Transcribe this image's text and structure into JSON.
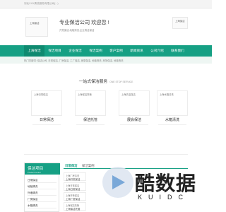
{
  "topbar": {
    "text": "河北XXX清洗服务有限公司(...)"
  },
  "header": {
    "logo": "上海保洁",
    "slogan": "专业保洁公司 欢迎您 !",
    "sub_slogan": "开荒保洁,地毯清洗,企业清洁保洁",
    "hotline": "上海保洁"
  },
  "nav": {
    "items": [
      "上海保洁",
      "保洁项目",
      "企业保洁",
      "保洁案例",
      "客户案例",
      "新闻资讯",
      "公司介绍",
      "联系我们"
    ],
    "active_index": 0
  },
  "keywords": "热门关键词: 保洁公司, 日常保洁, 厂房保洁, 工厂保洁, 家居保洁, 地毯清洗, 商场保洁, 地毯清洗",
  "services": {
    "title": "一站式保洁服务",
    "subtitle": "ONE STOP SERVICE",
    "items": [
      {
        "image_label": "上海日常保洁",
        "name": "日常保洁"
      },
      {
        "image_label": "上海保洁托管",
        "name": "保洁托管"
      },
      {
        "image_label": "上海清洁保洁",
        "name": "展会保洁"
      },
      {
        "image_label": "上海水箱清洗",
        "name": "水箱清洗"
      }
    ]
  },
  "product_center": {
    "title": "保洁项目",
    "subtitle": "Product Center",
    "items": [
      "日常保洁",
      "地毯清洗",
      "外墙清洗",
      "厂房保洁",
      "水箱清洗"
    ]
  },
  "tabs": {
    "items": [
      "日常保洁",
      "保洁案例"
    ],
    "active_index": 0
  },
  "products": [
    {
      "image_label": "上海厂房清洗",
      "name": "上海开荒保洁"
    },
    {
      "image_label": "上海日常保洁",
      "name": "上海日常保洁"
    },
    {
      "image_label": "上海开荒保洁",
      "name": "上海厂房保洁"
    },
    {
      "image_label": "上海保洁托管",
      "name": "上海保洁托管"
    }
  ],
  "watermark": {
    "cn": "酷数据",
    "latin": "KUIDC"
  },
  "colors": {
    "brand": "#16a084",
    "brand_dark": "#0f8a70"
  }
}
